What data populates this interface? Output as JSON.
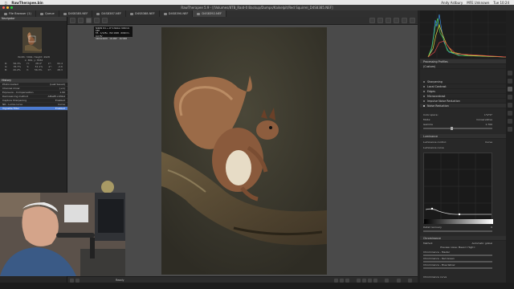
{
  "menubar": {
    "app": "RawTherapee.bin",
    "right_items": [
      "Andy Astbury",
      "MFE Unknown",
      "Tue 10:24"
    ]
  },
  "window": {
    "title": "RawTherapee 5.9 - [/Volumes/8TB_Raid-0 Backup/Dumps/Kaikelpit/Red Squirrel_D4S8385.NEF]"
  },
  "tabs": [
    {
      "label": "File Browser (1)",
      "active": false
    },
    {
      "label": "Queue",
      "active": false
    },
    {
      "label": "D4S8385.NEF",
      "active": false
    },
    {
      "label": "D4S8387.NEF",
      "active": false
    },
    {
      "label": "D4S8388.NEF",
      "active": false
    },
    {
      "label": "D4S8390.NEF",
      "active": false
    },
    {
      "label": "D4S8392.NEF",
      "active": true
    }
  ],
  "left": {
    "navigator_title": "Navigator",
    "image_info": "Width: 3464, Height: 4928",
    "zoom_line": "x: 384, y: 3582",
    "nav_values": [
      [
        "R:",
        "56.3%",
        "H:",
        "28.4°",
        "L*:",
        "62.4"
      ],
      [
        "G:",
        "35.7%",
        "S:",
        "51.1%",
        "a*:",
        "-2.6"
      ],
      [
        "B:",
        "20.2%",
        "V:",
        "56.3%",
        "b*:",
        "28.3"
      ]
    ],
    "history_title": "History",
    "history": [
      {
        "label": "Photo loaded",
        "value": "(Last Saved)",
        "selected": false
      },
      {
        "label": "Channel mixer",
        "value": "(+1)",
        "selected": false
      },
      {
        "label": "Exposure - Compensation",
        "value": "1.90",
        "selected": false
      },
      {
        "label": "Demosaicing method",
        "value": "AMaZE+VNG4",
        "selected": false
      },
      {
        "label": "Capture Sharpening",
        "value": "Enabled",
        "selected": false
      },
      {
        "label": "NR - Luma curve",
        "value": "Curve",
        "selected": false
      },
      {
        "label": "Vignette Filter",
        "value": "Enabled",
        "selected": true
      }
    ]
  },
  "osd": {
    "line1": "NIKON D4 + AF-S Nikkor 600mm f/4E",
    "line2": "f/5 · 1/125s · ISO 1600 · 600mm · 0.0 EV",
    "line3": "3464x4928 · 16.9MP · 18.5MB"
  },
  "bottom": {
    "status": "Ready"
  },
  "right": {
    "processing_profiles_title": "Processing Profiles",
    "profile_value": "(Custom)",
    "sections": [
      "Sharpening",
      "Local Contrast",
      "Edges",
      "Microcontrast",
      "Impulse Noise Reduction",
      "Noise Reduction"
    ],
    "color_space_label": "Color space:",
    "color_space_value": "L*a*b*",
    "mode_label": "Mode:",
    "mode_value": "Conservative",
    "gamma_label": "Gamma",
    "gamma_value": "1.700",
    "luminance_title": "Luminance",
    "luminance_control_label": "Luminance control:",
    "luminance_control_value": "Curve",
    "luminance_curve_label": "Luminance curve",
    "detail_recovery_label": "Detail recovery",
    "detail_recovery_value": "0",
    "chrominance_title": "Chrominance",
    "chroma_method_label": "Method:",
    "chroma_method_value": "Automatic global",
    "chroma_preview": "Preview noise: Mean=  High=",
    "chroma_rows": [
      "Chrominance - Master",
      "Chrominance - Red-Green",
      "Chrominance - Blue-Yellow"
    ],
    "chroma_curve_label": "Chrominance curve"
  },
  "colors": {
    "accent": "#4c7bd1",
    "panel": "#262626",
    "editor_bg": "#4a4a4a",
    "squirrel_fur": "#8a5a3c"
  }
}
